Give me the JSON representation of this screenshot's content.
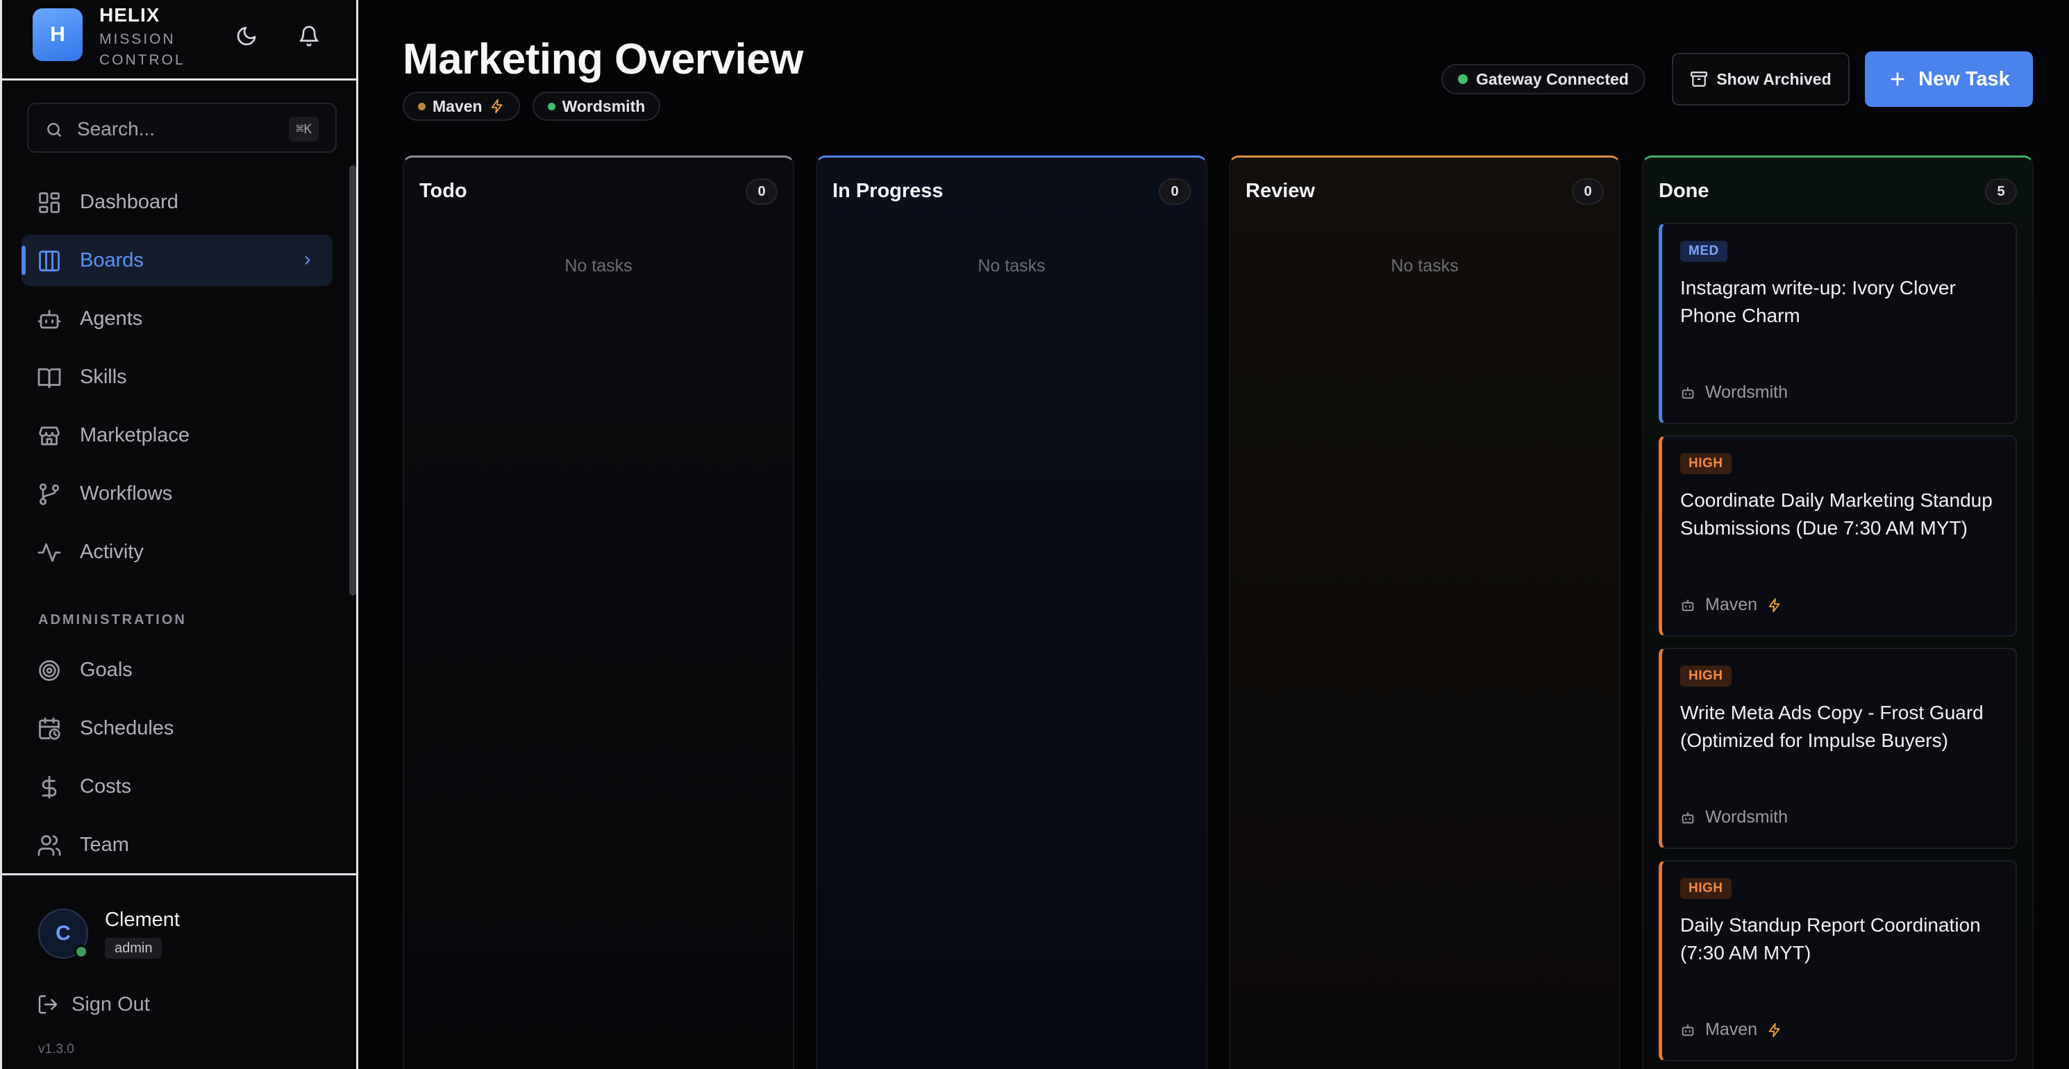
{
  "brand": {
    "logo_letter": "H",
    "name": "HELIX",
    "subtitle": "MISSION CONTROL"
  },
  "search": {
    "placeholder": "Search...",
    "shortcut": "⌘K"
  },
  "nav": {
    "items": [
      {
        "label": "Dashboard",
        "icon": "dashboard-icon"
      },
      {
        "label": "Boards",
        "icon": "board-columns-icon",
        "active": true
      },
      {
        "label": "Agents",
        "icon": "robot-icon"
      },
      {
        "label": "Skills",
        "icon": "book-icon"
      },
      {
        "label": "Marketplace",
        "icon": "store-icon"
      },
      {
        "label": "Workflows",
        "icon": "git-branch-icon"
      },
      {
        "label": "Activity",
        "icon": "activity-icon"
      }
    ],
    "admin_label": "ADMINISTRATION",
    "admin_items": [
      {
        "label": "Goals",
        "icon": "target-icon"
      },
      {
        "label": "Schedules",
        "icon": "calendar-clock-icon"
      },
      {
        "label": "Costs",
        "icon": "dollar-icon"
      },
      {
        "label": "Team",
        "icon": "users-icon"
      }
    ]
  },
  "user": {
    "initial": "C",
    "name": "Clement",
    "role": "admin",
    "signout_label": "Sign Out",
    "version": "v1.3.0"
  },
  "header": {
    "title": "Marketing Overview",
    "agents": [
      {
        "name": "Maven",
        "dot_color": "#b8863a",
        "bolt": true
      },
      {
        "name": "Wordsmith",
        "dot_color": "#3fbf6a",
        "bolt": false
      }
    ],
    "gateway_status": "Gateway Connected",
    "show_archived_label": "Show Archived",
    "new_task_label": "New Task"
  },
  "colors": {
    "accent": "#4b83ee",
    "todo": "#8a8f99",
    "in_progress": "#4b83ee",
    "review": "#e0913a",
    "done": "#3fae66",
    "prio_high": "#e8763a",
    "prio_med": "#4b83ee"
  },
  "board": {
    "columns": [
      {
        "title": "Todo",
        "count": "0",
        "empty": "No tasks"
      },
      {
        "title": "In Progress",
        "count": "0",
        "empty": "No tasks"
      },
      {
        "title": "Review",
        "count": "0",
        "empty": "No tasks"
      },
      {
        "title": "Done",
        "count": "5",
        "empty": ""
      }
    ],
    "done_tasks": [
      {
        "priority": "MED",
        "title": "Instagram write-up: Ivory Clover Phone Charm",
        "agent": "Wordsmith",
        "bolt": false
      },
      {
        "priority": "HIGH",
        "title": "Coordinate Daily Marketing Standup Submissions (Due 7:30 AM MYT)",
        "agent": "Maven",
        "bolt": true
      },
      {
        "priority": "HIGH",
        "title": "Write Meta Ads Copy - Frost Guard (Optimized for Impulse Buyers)",
        "agent": "Wordsmith",
        "bolt": false
      },
      {
        "priority": "HIGH",
        "title": "Daily Standup Report Coordination (7:30 AM MYT)",
        "agent": "Maven",
        "bolt": true
      }
    ]
  }
}
